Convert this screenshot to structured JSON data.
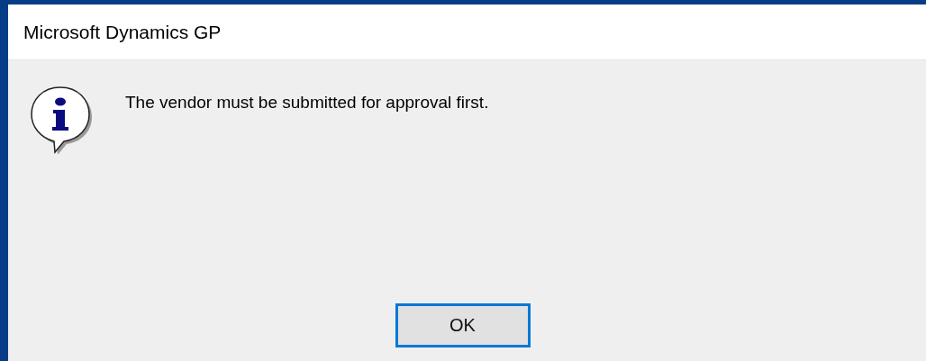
{
  "window": {
    "title": "Microsoft Dynamics GP"
  },
  "message": "The vendor must be submitted for approval first.",
  "buttons": [
    {
      "label": "OK",
      "focused": true
    }
  ]
}
